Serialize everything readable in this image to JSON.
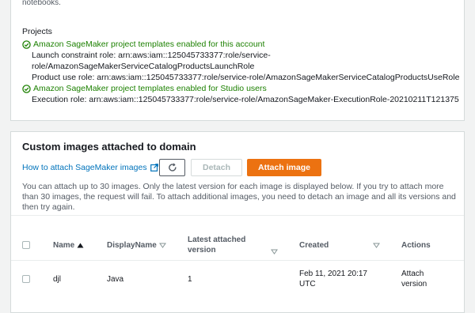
{
  "top_note": "notebooks.",
  "projects": {
    "title": "Projects",
    "account_enabled": "Amazon SageMaker project templates enabled for this account",
    "launch_role_line1": "Launch constraint role: arn:aws:iam::125045733377:role/service-",
    "launch_role_line2": "role/AmazonSageMakerServiceCatalogProductsLaunchRole",
    "product_use_role": "Product use role: arn:aws:iam::125045733377:role/service-role/AmazonSageMakerServiceCatalogProductsUseRole",
    "studio_enabled": "Amazon SageMaker project templates enabled for Studio users",
    "execution_role": "Execution role: arn:aws:iam::125045733377:role/service-role/AmazonSageMaker-ExecutionRole-20210211T121375"
  },
  "custom_images": {
    "title": "Custom images attached to domain",
    "howto_link": "How to attach SageMaker images",
    "detach_label": "Detach",
    "attach_label": "Attach image",
    "description": "You can attach up to 30 images. Only the latest version for each image is displayed below. If you try to attach more than 30 images, the request will fail. To attach additional images, you need to detach an image and all its versions and then try again.",
    "columns": {
      "name": "Name",
      "display_name": "DisplayName",
      "latest_version_line1": "Latest attached",
      "latest_version_line2": "version",
      "created": "Created",
      "actions": "Actions"
    },
    "rows": [
      {
        "name": "djl",
        "display_name": "Java",
        "version": "1",
        "created_line1": "Feb 11, 2021 20:17",
        "created_line2": "UTC",
        "action_line1": "Attach",
        "action_line2": "version"
      }
    ]
  },
  "colors": {
    "success": "#1d8102",
    "link": "#0073bb",
    "primary_button": "#ec7211"
  }
}
